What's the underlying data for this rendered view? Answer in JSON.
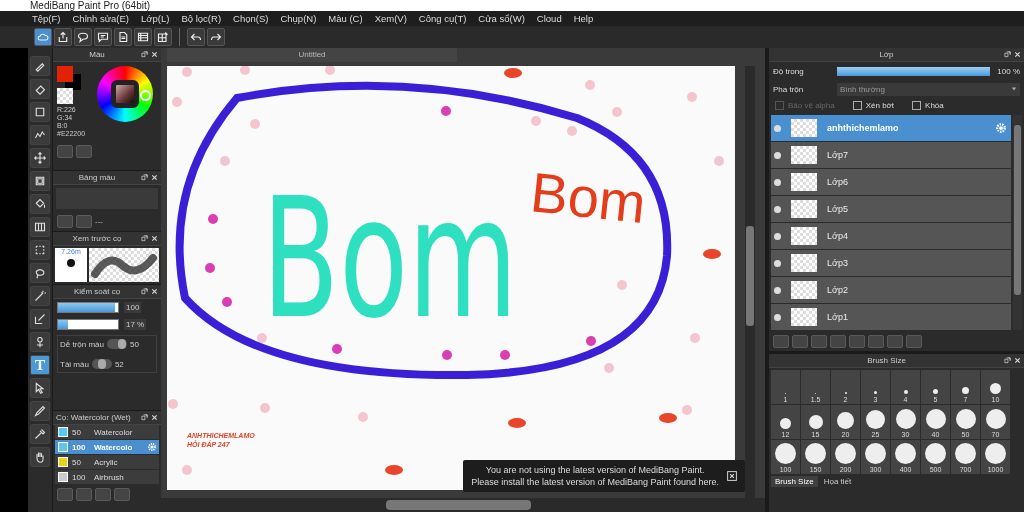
{
  "window": {
    "title": "MediBang Paint Pro (64bit)"
  },
  "menu": [
    "Tệp(F)",
    "Chỉnh sửa(E)",
    "Lớp(L)",
    "Bộ lọc(R)",
    "Chọn(S)",
    "Chụp(N)",
    "Màu (C)",
    "Xem(V)",
    "Công cụ(T)",
    "Cửa sổ(W)",
    "Cloud",
    "Help"
  ],
  "toolbar": [
    {
      "kind": "cloud",
      "selected": true
    },
    {
      "kind": "export",
      "selected": false
    },
    {
      "kind": "chat",
      "selected": false
    },
    {
      "kind": "comment",
      "selected": false
    },
    {
      "kind": "page",
      "selected": false
    },
    {
      "kind": "list",
      "selected": false
    },
    {
      "kind": "grid",
      "selected": false
    },
    {
      "kind": "undo",
      "selected": false
    },
    {
      "kind": "redo",
      "selected": false
    }
  ],
  "tools": [
    {
      "kind": "brush",
      "selected": false
    },
    {
      "kind": "eraser",
      "selected": false
    },
    {
      "kind": "square",
      "selected": false
    },
    {
      "kind": "zigzag",
      "selected": false
    },
    {
      "kind": "move",
      "selected": false
    },
    {
      "kind": "filled-square",
      "selected": false
    },
    {
      "kind": "bucket",
      "selected": false
    },
    {
      "kind": "gradient",
      "selected": false
    },
    {
      "kind": "dashed-square",
      "selected": false
    },
    {
      "kind": "lasso",
      "selected": false
    },
    {
      "kind": "wand",
      "selected": false
    },
    {
      "kind": "pen-square",
      "selected": false
    },
    {
      "kind": "pin",
      "selected": false
    },
    {
      "kind": "text",
      "glyph": "T",
      "selected": true
    },
    {
      "kind": "pointer",
      "selected": false
    },
    {
      "kind": "pen",
      "selected": false
    },
    {
      "kind": "dropper",
      "selected": false
    },
    {
      "kind": "hand",
      "selected": false
    }
  ],
  "color_panel": {
    "title": "Màu",
    "readings": [
      "R:226",
      "G:34",
      "B:0",
      "#E22200"
    ]
  },
  "palette_panel": {
    "title": "Bảng màu",
    "value": "---"
  },
  "preview_panel": {
    "title": "Xem trước cọ",
    "size": "7.26m"
  },
  "brush_control": {
    "title": "Kiểm soát cọ",
    "sliders": [
      {
        "level": 0.95,
        "reading": "100"
      },
      {
        "level": 0.17,
        "reading": "17 %"
      }
    ],
    "mix": [
      {
        "label": "Dễ trộn màu",
        "level": 0.9,
        "reading": "50"
      },
      {
        "label": "Tải màu",
        "level": 0.5,
        "reading": "52"
      }
    ]
  },
  "brush_list": {
    "title": "Cọ: Watercolor (Wet)",
    "items": [
      {
        "size": "50",
        "name": "Watercolor",
        "color": "#5bc8f0",
        "selected": false
      },
      {
        "size": "100",
        "name": "Watercolo",
        "color": "#5bc8f0",
        "selected": true
      },
      {
        "size": "50",
        "name": "Acrylic",
        "color": "#e8d21a",
        "selected": false
      },
      {
        "size": "100",
        "name": "Airbrush",
        "color": "#cccccc",
        "selected": false
      }
    ]
  },
  "document": {
    "tab": "Untitled",
    "big_word": "Bom",
    "small_word": "Bom",
    "caption": [
      "ANHTHICHEMLAMO",
      "HỎI ĐÁP 247"
    ]
  },
  "notification": {
    "lines": [
      "You are not using the latest version of MediBang Paint.",
      "Please install the latest version of MediBang Paint found here."
    ]
  },
  "layer_panel": {
    "title": "Lớp",
    "opacity_label": "Độ trong",
    "opacity": {
      "level": 1,
      "reading": "100 %"
    },
    "blend_label": "Pha trộn",
    "blend": "Bình thường",
    "options": [
      {
        "label": "Bảo vệ alpha",
        "checked": false,
        "disabled": true
      },
      {
        "label": "Xén bớt",
        "checked": false,
        "disabled": false
      },
      {
        "label": "Khóa",
        "checked": false,
        "disabled": false
      }
    ],
    "layers": [
      {
        "name": "anhthichemlamo",
        "selected": true
      },
      {
        "name": "Lớp7",
        "selected": false
      },
      {
        "name": "Lớp6",
        "selected": false
      },
      {
        "name": "Lớp5",
        "selected": false
      },
      {
        "name": "Lớp4",
        "selected": false
      },
      {
        "name": "Lớp3",
        "selected": false
      },
      {
        "name": "Lớp2",
        "selected": false
      },
      {
        "name": "Lớp1",
        "selected": false
      }
    ]
  },
  "brush_size_panel": {
    "title": "Brush Size",
    "sizes": [
      "1",
      "1.5",
      "2",
      "3",
      "4",
      "5",
      "7",
      "10",
      "12",
      "15",
      "20",
      "25",
      "30",
      "40",
      "50",
      "70",
      "100",
      "150",
      "200",
      "300",
      "400",
      "500",
      "700",
      "1000"
    ],
    "tabs": [
      {
        "label": "Brush Size",
        "selected": true
      },
      {
        "label": "Họa tiết",
        "selected": false
      }
    ]
  }
}
